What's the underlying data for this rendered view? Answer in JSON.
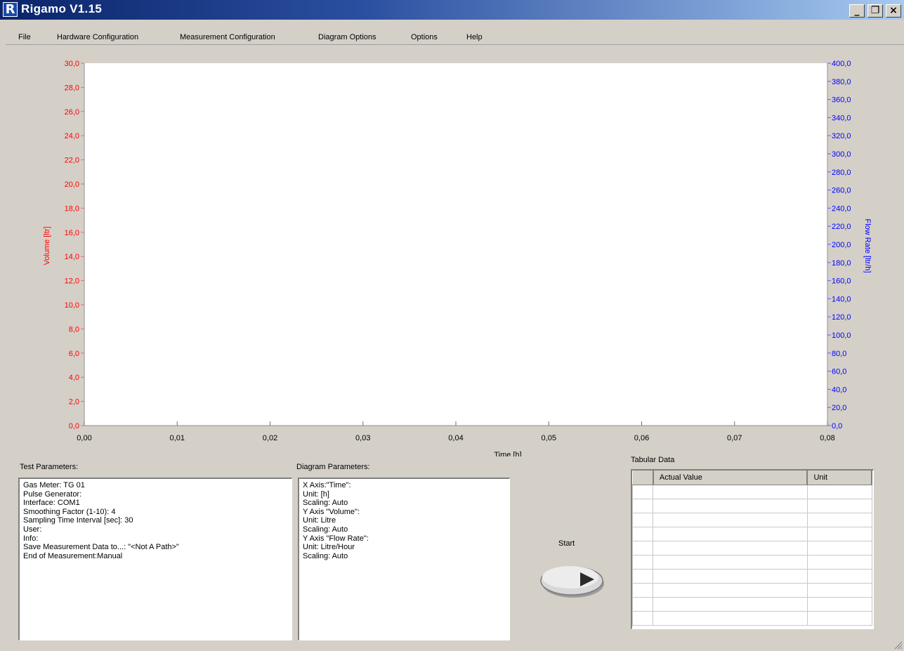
{
  "window": {
    "logo_letter": "R",
    "title": "Rigamo V1.15",
    "minimize": "_",
    "restore": "❐",
    "close": "×"
  },
  "menu": {
    "items": [
      {
        "label": "File"
      },
      {
        "label": "Hardware Configuration"
      },
      {
        "label": "Measurement Configuration"
      },
      {
        "label": "Diagram Options"
      },
      {
        "label": "Options"
      },
      {
        "label": "Help"
      }
    ]
  },
  "colors": {
    "volume_axis": "#ff0000",
    "flow_axis": "#0000ff",
    "plot_bg": "#ffffff"
  },
  "chart_data": {
    "type": "line",
    "xlabel": "Time [h]",
    "ylabel": "Volume [ltr]",
    "y2label": "Flow Rate [ltr/h]",
    "xlim": [
      0,
      0.08
    ],
    "ylim": [
      0,
      30
    ],
    "y2lim": [
      0,
      400
    ],
    "x_ticks": [
      "0,00",
      "0,01",
      "0,02",
      "0,03",
      "0,04",
      "0,05",
      "0,06",
      "0,07",
      "0,08"
    ],
    "y_ticks": [
      "0,0",
      "2,0",
      "4,0",
      "6,0",
      "8,0",
      "10,0",
      "12,0",
      "14,0",
      "16,0",
      "18,0",
      "20,0",
      "22,0",
      "24,0",
      "26,0",
      "28,0",
      "30,0"
    ],
    "y2_ticks": [
      "0,0",
      "20,0",
      "40,0",
      "60,0",
      "80,0",
      "100,0",
      "120,0",
      "140,0",
      "160,0",
      "180,0",
      "200,0",
      "220,0",
      "240,0",
      "260,0",
      "280,0",
      "300,0",
      "320,0",
      "340,0",
      "360,0",
      "380,0",
      "400,0"
    ],
    "series": [],
    "grid": false
  },
  "test_parameters": {
    "label": "Test Parameters:",
    "lines": [
      "Gas Meter: TG 01",
      "Pulse Generator:",
      "Interface: COM1",
      "Smoothing Factor (1-10): 4",
      "Sampling Time Interval [sec]: 30",
      "User:",
      "Info:",
      "Save Measurement Data to...: \"<Not A Path>\"",
      "End of Measurement:Manual"
    ]
  },
  "diagram_parameters": {
    "label": "Diagram Parameters:",
    "lines": [
      "X Axis:\"Time\":",
      "Unit: [h]",
      "Scaling: Auto",
      "Y Axis \"Volume\":",
      "Unit: Litre",
      "Scaling: Auto",
      "Y Axis \"Flow Rate\":",
      "Unit: Litre/Hour",
      "Scaling: Auto"
    ]
  },
  "start": {
    "label": "Start"
  },
  "tabular_data": {
    "label": "Tabular Data",
    "columns": [
      "",
      "Actual Value",
      "Unit"
    ],
    "rows": [
      [
        "",
        "",
        ""
      ],
      [
        "",
        "",
        ""
      ],
      [
        "",
        "",
        ""
      ],
      [
        "",
        "",
        ""
      ],
      [
        "",
        "",
        ""
      ],
      [
        "",
        "",
        ""
      ],
      [
        "",
        "",
        ""
      ],
      [
        "",
        "",
        ""
      ],
      [
        "",
        "",
        ""
      ],
      [
        "",
        "",
        ""
      ]
    ]
  }
}
